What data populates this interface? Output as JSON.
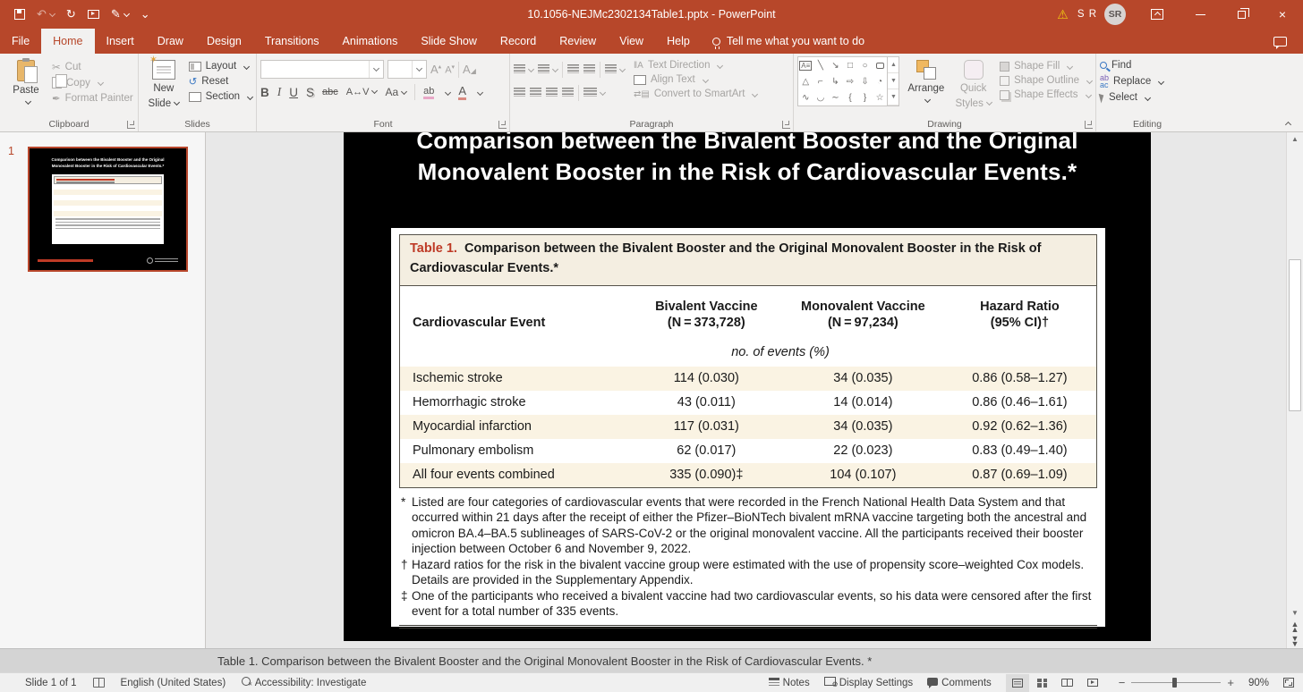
{
  "titlebar": {
    "title": "10.1056-NEJMc2302134Table1.pptx - PowerPoint",
    "user_name": "S R",
    "avatar_initials": "SR"
  },
  "ribbon": {
    "tabs": [
      "File",
      "Home",
      "Insert",
      "Draw",
      "Design",
      "Transitions",
      "Animations",
      "Slide Show",
      "Record",
      "Review",
      "View",
      "Help"
    ],
    "active_tab": "Home",
    "tell_me": "Tell me what you want to do",
    "clipboard": {
      "label": "Clipboard",
      "paste": "Paste",
      "cut": "Cut",
      "copy": "Copy",
      "format_painter": "Format Painter"
    },
    "slides": {
      "label": "Slides",
      "new_slide_1": "New",
      "new_slide_2": "Slide",
      "layout": "Layout",
      "reset": "Reset",
      "section": "Section"
    },
    "font": {
      "label": "Font"
    },
    "paragraph": {
      "label": "Paragraph",
      "text_direction": "Text Direction",
      "align_text": "Align Text",
      "convert_to_smartart": "Convert to SmartArt"
    },
    "drawing": {
      "label": "Drawing",
      "arrange": "Arrange",
      "quick_styles_1": "Quick",
      "quick_styles_2": "Styles",
      "shape_fill": "Shape Fill",
      "shape_outline": "Shape Outline",
      "shape_effects": "Shape Effects"
    },
    "editing": {
      "label": "Editing",
      "find": "Find",
      "replace": "Replace",
      "select": "Select"
    }
  },
  "slide_panel": {
    "slide_number": "1"
  },
  "slide": {
    "title_line1": "Comparison between the Bivalent Booster and the Original",
    "title_line2": "Monovalent Booster in the Risk of Cardiovascular Events.*"
  },
  "table": {
    "caption_label": "Table 1.",
    "caption_text": "Comparison between the Bivalent Booster and the Original Monovalent Booster in the Risk of Cardiovascular Events.*",
    "columns": [
      {
        "line1": "Cardiovascular Event",
        "line2": ""
      },
      {
        "line1": "Bivalent Vaccine",
        "line2": "(N = 373,728)"
      },
      {
        "line1": "Monovalent Vaccine",
        "line2": "(N = 97,234)"
      },
      {
        "line1": "Hazard Ratio",
        "line2": "(95% CI)†"
      }
    ],
    "subheader": "no. of events (%)",
    "rows": [
      {
        "event": "Ischemic stroke",
        "bivalent": "114 (0.030)",
        "monovalent": "34 (0.035)",
        "hazard_ratio": "0.86 (0.58–1.27)"
      },
      {
        "event": "Hemorrhagic stroke",
        "bivalent": "43 (0.011)",
        "monovalent": "14 (0.014)",
        "hazard_ratio": "0.86 (0.46–1.61)"
      },
      {
        "event": "Myocardial infarction",
        "bivalent": "117 (0.031)",
        "monovalent": "34 (0.035)",
        "hazard_ratio": "0.92 (0.62–1.36)"
      },
      {
        "event": "Pulmonary embolism",
        "bivalent": "62 (0.017)",
        "monovalent": "22 (0.023)",
        "hazard_ratio": "0.83 (0.49–1.40)"
      },
      {
        "event": "All four events combined",
        "bivalent": "335 (0.090)‡",
        "monovalent": "104 (0.107)",
        "hazard_ratio": "0.87 (0.69–1.09)"
      }
    ],
    "footnotes": [
      {
        "marker": "*",
        "text": "Listed are four categories of cardiovascular events that were recorded in the French National Health Data System and that occurred within 21 days after the receipt of either the Pfizer–BioNTech bivalent mRNA vaccine targeting both the ancestral and omicron BA.4–BA.5 sublineages of SARS-CoV-2 or the original monovalent vaccine. All the participants received their booster injection between October 6 and November 9, 2022."
      },
      {
        "marker": "†",
        "text": "Hazard ratios for the risk in the bivalent vaccine group were estimated with the use of propensity score–weighted Cox models. Details are provided in the Supplementary Appendix."
      },
      {
        "marker": "‡",
        "text": "One of the participants who received a bivalent vaccine had two cardiovascular events, so his data were censored after the first event for a total number of 335 events."
      }
    ]
  },
  "notes_pane": {
    "text": "Table 1. Comparison between the Bivalent Booster and the Original Monovalent Booster in the Risk of Cardiovascular Events. *"
  },
  "statusbar": {
    "slide_indicator": "Slide 1 of 1",
    "language": "English (United States)",
    "accessibility": "Accessibility: Investigate",
    "notes": "Notes",
    "display_settings": "Display Settings",
    "comments": "Comments",
    "zoom_level": "90%"
  },
  "colors": {
    "titlebar_accent": "#B7472A",
    "nejm_red": "#BE3A26",
    "table_row_cream": "#FAF3E3",
    "caption_band": "#F4EEE1",
    "slide_background": "#000000",
    "warning_yellow": "#F2C811"
  }
}
